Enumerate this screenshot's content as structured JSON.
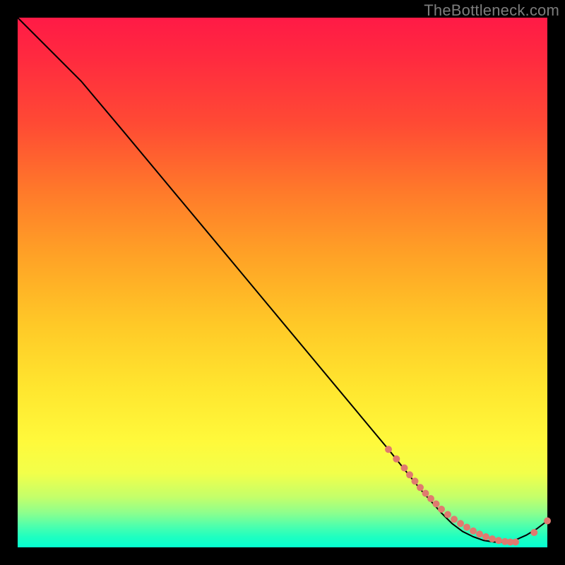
{
  "watermark": "TheBottleneck.com",
  "colors": {
    "dot": "#e07a6f",
    "stroke": "#000000",
    "background": "#000000",
    "gradient_top": "#ff1a46",
    "gradient_mid": "#ffe62f",
    "gradient_bottom": "#05ffd1"
  },
  "chart_data": {
    "type": "line",
    "title": "",
    "xlabel": "",
    "ylabel": "",
    "xlim": [
      0,
      100
    ],
    "ylim": [
      0,
      100
    ],
    "grid": false,
    "note": "Axes unlabeled; values are estimated from pixel positions on a 0-100 normalized scale (y: 0 at bottom, 100 at top).",
    "series": [
      {
        "name": "curve",
        "x": [
          0,
          3,
          7,
          12,
          20,
          30,
          40,
          50,
          60,
          70,
          76,
          80,
          82,
          84,
          86,
          88,
          90,
          92,
          94,
          96,
          98,
          100
        ],
        "y": [
          100,
          97,
          93,
          88,
          78.5,
          66.5,
          54.5,
          42.5,
          30.5,
          18.5,
          11,
          6.5,
          4.5,
          3,
          2,
          1.3,
          1,
          1,
          1.4,
          2.3,
          3.5,
          5
        ]
      }
    ],
    "points": {
      "name": "dots",
      "note": "Clustered salmon markers along the lower segment of the curve.",
      "x": [
        70,
        71.5,
        73,
        74,
        75,
        76,
        77,
        78,
        79,
        80,
        81.2,
        82.4,
        83.6,
        84.8,
        86,
        87.2,
        88.4,
        89.6,
        90.8,
        92,
        93,
        94,
        97.5,
        100
      ],
      "y": [
        18.5,
        16.7,
        15,
        13.7,
        12.5,
        11.3,
        10.2,
        9.2,
        8.2,
        7.2,
        6.2,
        5.3,
        4.5,
        3.8,
        3.1,
        2.5,
        2,
        1.6,
        1.3,
        1.1,
        1,
        1,
        2.8,
        5
      ]
    }
  }
}
